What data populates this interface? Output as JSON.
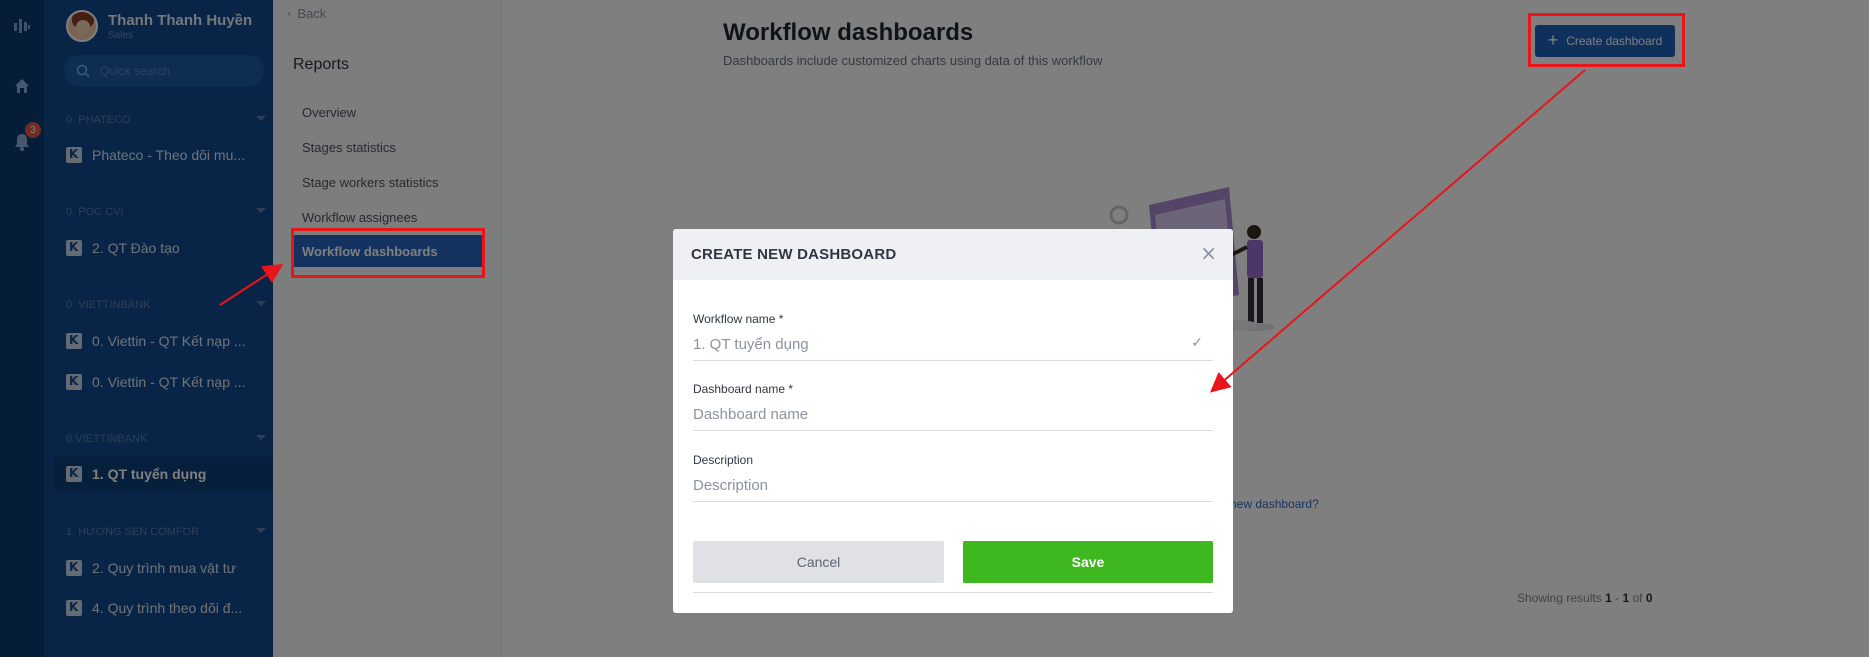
{
  "user": {
    "name": "Thanh Thanh Huyền",
    "role": "Sales"
  },
  "search": {
    "placeholder": "Quick search"
  },
  "rail": {
    "notification_count": "3"
  },
  "sidebar": {
    "groups": [
      {
        "label": "0. PHATECO",
        "items": [
          "Phateco - Theo dõi mu..."
        ]
      },
      {
        "label": "0. POC CVI",
        "items": [
          "2. QT Đào tạo"
        ]
      },
      {
        "label": "0. VIETTINBANK",
        "items": [
          "0. Viettin - QT Kết nạp ...",
          "0. Viettin - QT Kết nạp ..."
        ]
      },
      {
        "label": "0.VIETTINBANK",
        "items": [
          "1. QT tuyển dụng"
        ]
      },
      {
        "label": "1. HƯƠNG SEN COMFOR",
        "items": [
          "2. Quy trình mua vật tư",
          "4. Quy trình theo dõi đ..."
        ]
      }
    ]
  },
  "reports": {
    "back_label": "Back",
    "title": "Reports",
    "items": [
      "Overview",
      "Stages statistics",
      "Stage workers statistics",
      "Workflow assignees",
      "Workflow dashboards"
    ]
  },
  "main": {
    "title": "Workflow dashboards",
    "subtitle": "Dashboards include customized charts using data of this workflow",
    "create_button": "Create dashboard",
    "help_link": "e new dashboard?",
    "pagination": {
      "prefix": "Showing results",
      "from": "1",
      "to": "1",
      "total": "0",
      "sep": "-",
      "of": "of"
    }
  },
  "modal": {
    "title": "CREATE NEW DASHBOARD",
    "workflow_label": "Workflow name *",
    "workflow_value": "1. QT tuyển dụng",
    "dashboard_label": "Dashboard name *",
    "dashboard_placeholder": "Dashboard name",
    "description_label": "Description",
    "description_placeholder": "Description",
    "cancel": "Cancel",
    "save": "Save"
  },
  "colors": {
    "rail": "#0d3b73",
    "sidebar": "#114a8f",
    "primary": "#1f5eb9",
    "save": "#3fb81f",
    "annotation": "#e8161b"
  }
}
